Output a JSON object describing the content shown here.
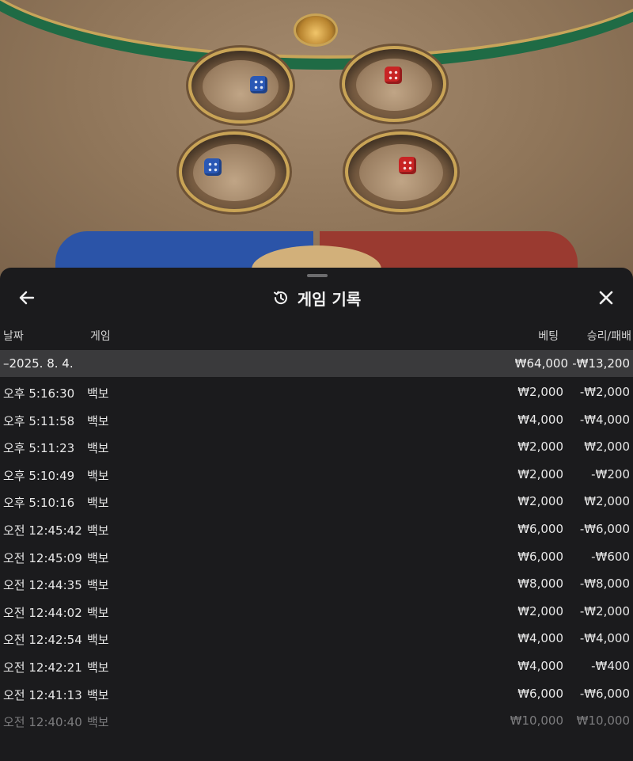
{
  "header": {
    "title": "게임 기록"
  },
  "columns": {
    "date": "날짜",
    "game": "게임",
    "bet": "베팅",
    "result": "승리/패배"
  },
  "summary": {
    "date": "–2025. 8. 4.",
    "bet": "₩64,000",
    "result": "-₩13,200"
  },
  "rows": [
    {
      "time": "오후 5:16:30",
      "game": "백보",
      "bet": "₩2,000",
      "result": "-₩2,000"
    },
    {
      "time": "오후 5:11:58",
      "game": "백보",
      "bet": "₩4,000",
      "result": "-₩4,000"
    },
    {
      "time": "오후 5:11:23",
      "game": "백보",
      "bet": "₩2,000",
      "result": "₩2,000"
    },
    {
      "time": "오후 5:10:49",
      "game": "백보",
      "bet": "₩2,000",
      "result": "-₩200"
    },
    {
      "time": "오후 5:10:16",
      "game": "백보",
      "bet": "₩2,000",
      "result": "₩2,000"
    },
    {
      "time": "오전 12:45:42",
      "game": "백보",
      "bet": "₩6,000",
      "result": "-₩6,000"
    },
    {
      "time": "오전 12:45:09",
      "game": "백보",
      "bet": "₩6,000",
      "result": "-₩600"
    },
    {
      "time": "오전 12:44:35",
      "game": "백보",
      "bet": "₩8,000",
      "result": "-₩8,000"
    },
    {
      "time": "오전 12:44:02",
      "game": "백보",
      "bet": "₩2,000",
      "result": "-₩2,000"
    },
    {
      "time": "오전 12:42:54",
      "game": "백보",
      "bet": "₩4,000",
      "result": "-₩4,000"
    },
    {
      "time": "오전 12:42:21",
      "game": "백보",
      "bet": "₩4,000",
      "result": "-₩400"
    },
    {
      "time": "오전 12:41:13",
      "game": "백보",
      "bet": "₩6,000",
      "result": "-₩6,000"
    },
    {
      "time": "오전 12:40:40",
      "game": "백보",
      "bet": "₩10,000",
      "result": "₩10,000"
    }
  ],
  "icons": {
    "back": "arrow-left-icon",
    "history": "history-clock-icon",
    "close": "close-icon"
  },
  "colors": {
    "panel_bg": "#1b1b1d",
    "summary_bg": "#3a3a3c",
    "text": "#e8e8e8",
    "faded_text": "#7c7c7e"
  }
}
